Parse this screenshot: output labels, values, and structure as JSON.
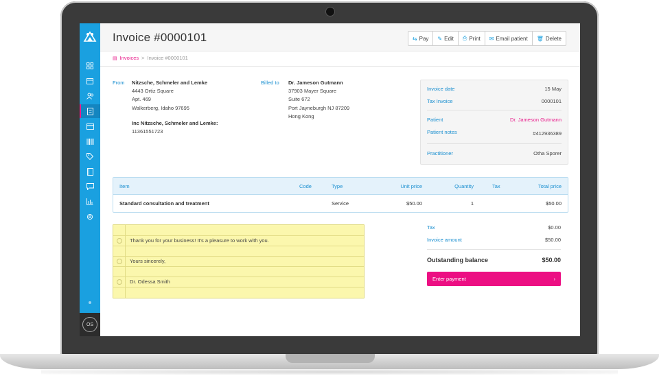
{
  "app": {
    "title": "Invoice #0000101",
    "accent": "#1aa0e0",
    "brand_pink": "#ec0f83"
  },
  "toolbar": {
    "pay": "Pay",
    "edit": "Edit",
    "print": "Print",
    "email": "Email patient",
    "delete": "Delete"
  },
  "breadcrumb": {
    "root": "Invoices",
    "separator": ">",
    "current": "Invoice #0000101"
  },
  "sidebar": {
    "icons": [
      "dashboard-icon",
      "calendar-icon",
      "patients-icon",
      "invoices-icon",
      "payments-icon",
      "barcode-icon",
      "tag-icon",
      "book-icon",
      "message-icon",
      "reports-icon",
      "settings-icon"
    ],
    "avatar_initials": "OS"
  },
  "from": {
    "label": "From",
    "name": "Nitzsche, Schmeler and Lemke",
    "line1": "4443 Ortiz Square",
    "line2": "Apt. 469",
    "line3": "Walkerberg, Idaho 97695",
    "company": "Inc Nitzsche, Schmeler and Lemke:",
    "number": "11361551723"
  },
  "billed_to": {
    "label": "Billed to",
    "name": "Dr. Jameson Gutmann",
    "line1": "37903 Mayer Square",
    "line2": "Suite 672",
    "line3": "Port Jayneburgh NJ 87209",
    "line4": "Hong Kong"
  },
  "info": {
    "invoice_date_label": "Invoice date",
    "invoice_date": "15 May",
    "tax_invoice_label": "Tax Invoice",
    "tax_invoice": "0000101",
    "patient_label": "Patient",
    "patient": "Dr. Jameson Gutmann",
    "patient_notes_label": "Patient notes",
    "patient_notes": "#412936389",
    "practitioner_label": "Practitioner",
    "practitioner": "Otha Sporer"
  },
  "items": {
    "headers": {
      "item": "Item",
      "code": "Code",
      "type": "Type",
      "unit_price": "Unit price",
      "quantity": "Quantity",
      "tax": "Tax",
      "total_price": "Total price"
    },
    "rows": [
      {
        "item": "Standard consultation and treatment",
        "code": "",
        "type": "Service",
        "unit_price": "$50.00",
        "quantity": "1",
        "tax": "",
        "total_price": "$50.00"
      }
    ]
  },
  "notes": {
    "lines": [
      "Thank you for your business! It's a pleasure to work with you.",
      "Yours sincerely,",
      "Dr. Odessa Smith"
    ]
  },
  "totals": {
    "tax_label": "Tax",
    "tax": "$0.00",
    "invoice_amount_label": "Invoice amount",
    "invoice_amount": "$50.00",
    "outstanding_label": "Outstanding balance",
    "outstanding": "$50.00",
    "enter_payment": "Enter payment",
    "enter_payment_icon": "chevron-right-icon"
  }
}
